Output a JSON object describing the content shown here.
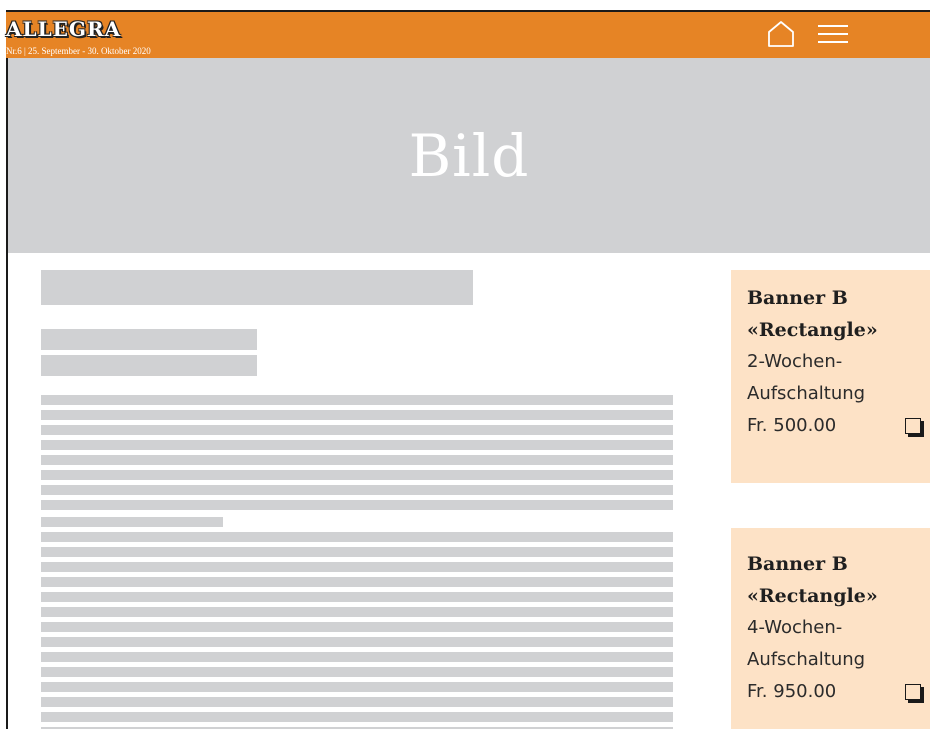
{
  "header": {
    "brand": "ALLEGRA",
    "issue": "Nr.6 | 25. September - 30. Oktober 2020",
    "home_icon": "home-icon",
    "menu_icon": "hamburger-menu-icon",
    "accent_color": "#e68425"
  },
  "hero": {
    "label": "Bild",
    "background_color": "#d0d1d3"
  },
  "ads": [
    {
      "title": "Banner B «Rectangle»",
      "duration": "2-Wochen-Aufschaltung",
      "price": "Fr. 500.00",
      "checked": false,
      "background_color": "#fde2c6"
    },
    {
      "title": "Banner B «Rectangle»",
      "duration": "4-Wochen-Aufschaltung",
      "price": "Fr. 950.00",
      "checked": false,
      "background_color": "#fde2c6"
    }
  ]
}
